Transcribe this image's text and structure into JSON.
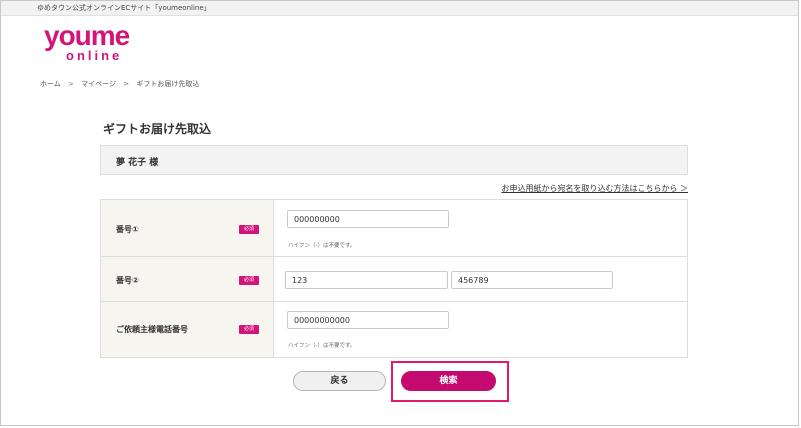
{
  "topbar": {
    "text": "ゆめタウン公式オンラインECサイト「youmeonline」"
  },
  "logo": {
    "main": "youme",
    "sub": "online"
  },
  "breadcrumb": {
    "items": [
      "ホーム",
      "マイページ",
      "ギフトお届け先取込"
    ],
    "separator": ">"
  },
  "page": {
    "title": "ギフトお届け先取込"
  },
  "customer": {
    "name": "夢 花子 様"
  },
  "help_link": "お申込用紙から宛名を取り込む方法はこちらから ＞",
  "form": {
    "required_label": "必須",
    "rows": [
      {
        "label": "番号①",
        "value": "000000000",
        "note": "ハイフン（-）は不要です。"
      },
      {
        "label": "番号②",
        "value1": "123",
        "value2": "456789"
      },
      {
        "label": "ご依頼主様電話番号",
        "value": "00000000000",
        "note": "ハイフン（-）は不要です。"
      }
    ]
  },
  "buttons": {
    "back": "戻る",
    "search": "検索"
  },
  "colors": {
    "brand": "#d3147a",
    "highlight": "#e3196f"
  }
}
